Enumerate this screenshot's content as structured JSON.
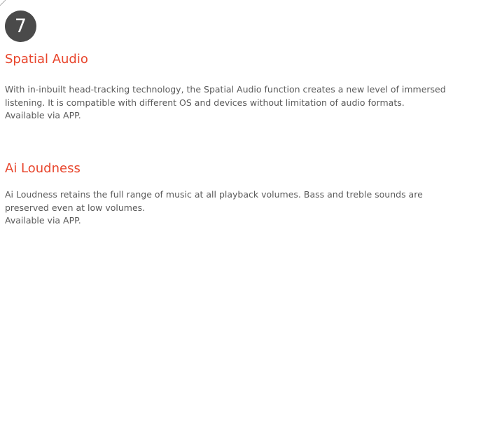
{
  "badge": {
    "number": "7",
    "color": "#4a4a4a"
  },
  "accent_color": "#e8452c",
  "sections": [
    {
      "title": "Spatial Audio",
      "description": "With in-inbuilt head-tracking technology, the Spatial Audio function creates a new level of immersed listening. It is compatible with different OS and devices without limitation of audio formats.",
      "availability": "Available via APP."
    },
    {
      "title": "Ai Loudness",
      "description": "Ai Loudness retains the full range of music at all playback volumes. Bass and treble sounds are preserved even at low volumes.",
      "availability": "Available via APP."
    }
  ]
}
